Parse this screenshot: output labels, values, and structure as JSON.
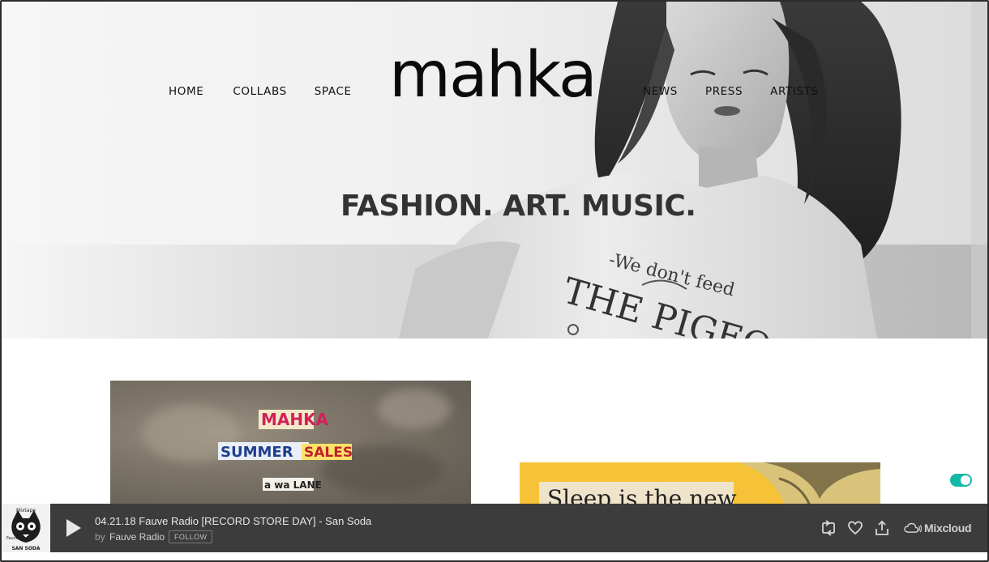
{
  "nav": {
    "left": [
      "HOME",
      "COLLABS",
      "SPACE"
    ],
    "right": [
      "NEWS",
      "PRESS",
      "ARTISTS"
    ]
  },
  "logo": "mahka",
  "tagline": "FASHION. ART. MUSIC.",
  "shirt_text": {
    "line1": "-We don't feed",
    "line2": "THE PIGEO"
  },
  "cards": {
    "left": {
      "collage": [
        "MAHKA",
        "SUMMER",
        "SALES",
        "a wa LANE"
      ]
    },
    "right": {
      "headline": "Sleep is the new"
    }
  },
  "player": {
    "cover_text": [
      "Mixtape",
      "Fauve Radio",
      "SAN SODA"
    ],
    "track_title": "04.21.18 Fauve Radio [RECORD STORE DAY] - San Soda",
    "by_label": "by",
    "artist": "Fauve Radio",
    "follow_label": "FOLLOW",
    "brand": "Mixcloud",
    "icons": [
      "play-icon",
      "repost-icon",
      "heart-icon",
      "share-icon",
      "mixcloud-logo-icon"
    ]
  },
  "colors": {
    "accent_toggle": "#14b8a6",
    "player_bg": "#3c3c3c",
    "right_card_bg": "#f6c338"
  }
}
